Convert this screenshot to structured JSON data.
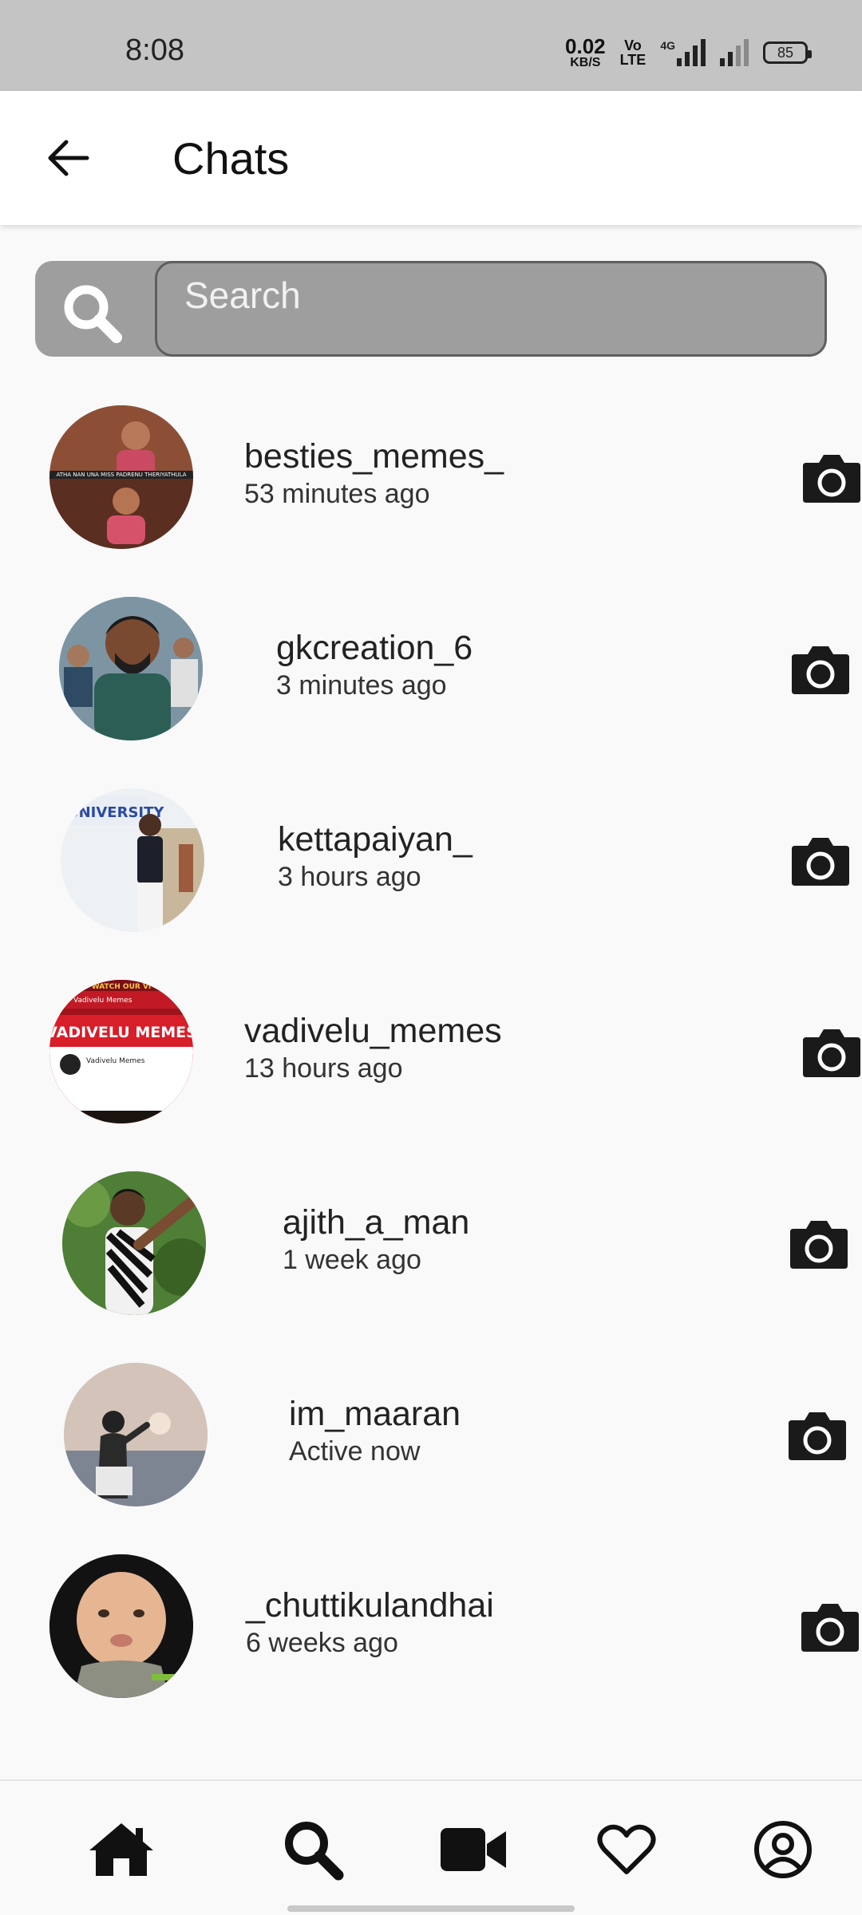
{
  "status_bar": {
    "time": "8:08",
    "net_speed": "0.02",
    "net_unit": "KB/S",
    "volte_top": "Vo",
    "volte_bottom": "LTE",
    "network": "4G",
    "battery": "85"
  },
  "header": {
    "title": "Chats"
  },
  "search": {
    "placeholder": "Search"
  },
  "chats": [
    {
      "name": "besties_memes_",
      "status": "53 minutes ago"
    },
    {
      "name": "gkcreation_6",
      "status": "3 minutes ago"
    },
    {
      "name": "kettapaiyan_",
      "status": "3 hours ago"
    },
    {
      "name": "vadivelu_memes",
      "status": "13 hours ago"
    },
    {
      "name": "ajith_a_man",
      "status": "1 week ago"
    },
    {
      "name": "im_maaran",
      "status": "Active now"
    },
    {
      "name": "_chuttikulandhai",
      "status": "6 weeks ago"
    }
  ],
  "avatar_texts": {
    "besties_top": "ATHA NAN UNA MISS PADRENU THERIYATHULA",
    "vadivelu_channel": "Vadivelu Memes",
    "vadivelu_banner": "VADIVELU MEMES",
    "vadivelu_top": "WATCH OUR VI",
    "university": "UNIVERSITY"
  },
  "nav": {
    "items": [
      "home-icon",
      "search-icon",
      "reels-icon",
      "heart-icon",
      "profile-icon"
    ]
  },
  "colors": {
    "status_bar": "#c4c4c4",
    "search_bg": "#9e9e9e",
    "page_bg": "#f9f9f9",
    "icon": "#1a1a1a"
  }
}
